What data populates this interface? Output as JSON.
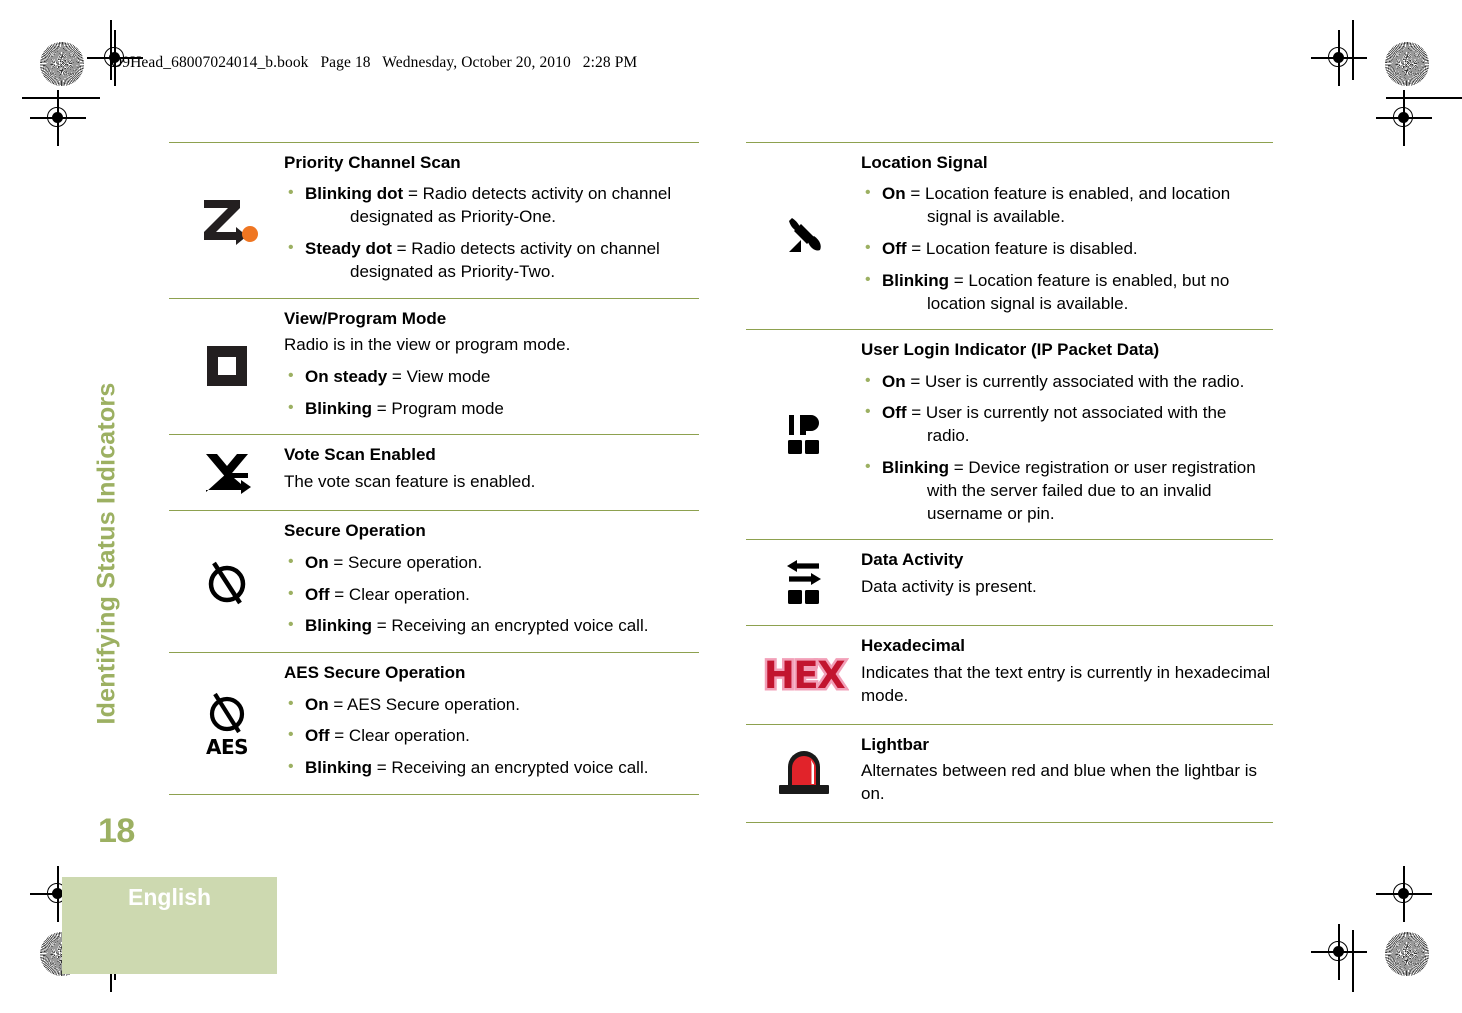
{
  "header": {
    "book_line": "O9Head_68007024014_b.book   Page 18   Wednesday, October 20, 2010   2:28 PM"
  },
  "running_head": {
    "chapter_title": "Identifying Status Indicators",
    "page_number": "18"
  },
  "footer": {
    "language": "English"
  },
  "colors": {
    "rule_green": "#8da14f",
    "accent_green": "#9cb062",
    "footer_green": "#cdd9b0",
    "bullet_green": "#9cb062",
    "orange_dot": "#ef7622",
    "hex_red": "#c2152f",
    "hex_pink": "#f2a0b8",
    "lightbar_red": "#e1232a"
  },
  "left_column": [
    {
      "icon": "priority-channel-scan-icon",
      "title": "Priority Channel Scan",
      "bullets": [
        {
          "label": "Blinking dot",
          "text": " = Radio detects activity on channel designated as Priority-One."
        },
        {
          "label": "Steady dot",
          "text": " = Radio detects activity on channel designated as Priority-Two."
        }
      ]
    },
    {
      "icon": "view-program-mode-icon",
      "title": "View/Program Mode",
      "description": "Radio is in the view or program mode.",
      "bullets": [
        {
          "label": "On steady",
          "text": " = View mode"
        },
        {
          "label": "Blinking",
          "text": " = Program mode"
        }
      ]
    },
    {
      "icon": "vote-scan-icon",
      "title": "Vote Scan Enabled",
      "description": "The vote scan feature is enabled.",
      "bullets": []
    },
    {
      "icon": "secure-operation-icon",
      "title": "Secure Operation",
      "bullets": [
        {
          "label": "On",
          "text": " = Secure operation."
        },
        {
          "label": "Off",
          "text": " = Clear operation."
        },
        {
          "label": "Blinking",
          "text": " = Receiving an encrypted voice call."
        }
      ]
    },
    {
      "icon": "aes-secure-operation-icon",
      "title": "AES Secure Operation",
      "bullets": [
        {
          "label": "On",
          "text": " = AES Secure operation."
        },
        {
          "label": "Off",
          "text": " = Clear operation."
        },
        {
          "label": "Blinking",
          "text": " = Receiving an encrypted voice call."
        }
      ]
    }
  ],
  "right_column": [
    {
      "icon": "location-signal-icon",
      "title": "Location Signal",
      "bullets": [
        {
          "label": "On",
          "text": " = Location feature is enabled, and location signal is available."
        },
        {
          "label": "Off",
          "text": " = Location feature is disabled."
        },
        {
          "label": "Blinking",
          "text": " = Location feature is enabled, but no location signal is available."
        }
      ]
    },
    {
      "icon": "ip-packet-data-icon",
      "title": "User Login Indicator (IP Packet Data)",
      "bullets": [
        {
          "label": "On",
          "text": " = User is currently associated with the radio."
        },
        {
          "label": "Off",
          "text": " = User is currently not associated with the radio."
        },
        {
          "label": "Blinking",
          "text": " = Device registration or user registration with the server failed due to an invalid username or pin."
        }
      ]
    },
    {
      "icon": "data-activity-icon",
      "title": "Data Activity",
      "description": "Data activity is present.",
      "bullets": []
    },
    {
      "icon": "hexadecimal-icon",
      "icon_text": "HEX",
      "title": "Hexadecimal",
      "description": "Indicates that the text entry is currently in hexadecimal mode.",
      "bullets": []
    },
    {
      "icon": "lightbar-icon",
      "title": "Lightbar",
      "description": "Alternates between red and blue when the lightbar is on.",
      "bullets": []
    }
  ]
}
